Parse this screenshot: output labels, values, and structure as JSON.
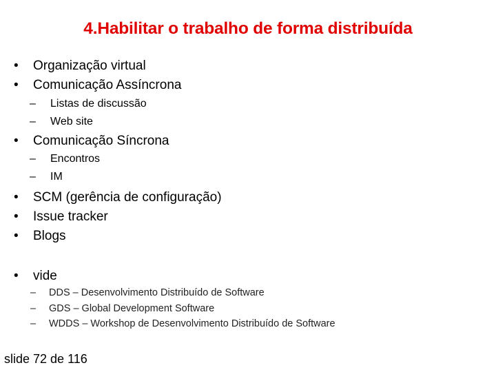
{
  "slide": {
    "title": "4.Habilitar o trabalho de forma distribuída",
    "bullet_glyph": "•",
    "dash_glyph": "–",
    "items": [
      {
        "level": 1,
        "text": "Organização virtual"
      },
      {
        "level": 1,
        "text": "Comunicação Assíncrona"
      },
      {
        "level": 2,
        "text": "Listas de discussão"
      },
      {
        "level": 2,
        "text": "Web site"
      },
      {
        "level": 1,
        "text": "Comunicação Síncrona"
      },
      {
        "level": 2,
        "text": "Encontros"
      },
      {
        "level": 2,
        "text": "IM"
      },
      {
        "level": 1,
        "text": "SCM (gerência de configuração)"
      },
      {
        "level": 1,
        "text": "Issue tracker"
      },
      {
        "level": 1,
        "text": "Blogs"
      },
      {
        "level": 1,
        "text": "vide"
      },
      {
        "level": 3,
        "text": "DDS – Desenvolvimento Distribuído de Software"
      },
      {
        "level": 3,
        "text": "GDS – Global Development Software"
      },
      {
        "level": 3,
        "text": "WDDS – Workshop de Desenvolvimento Distribuído de Software"
      }
    ],
    "footer": "slide 72 de 116",
    "title_color": "#e00000"
  }
}
